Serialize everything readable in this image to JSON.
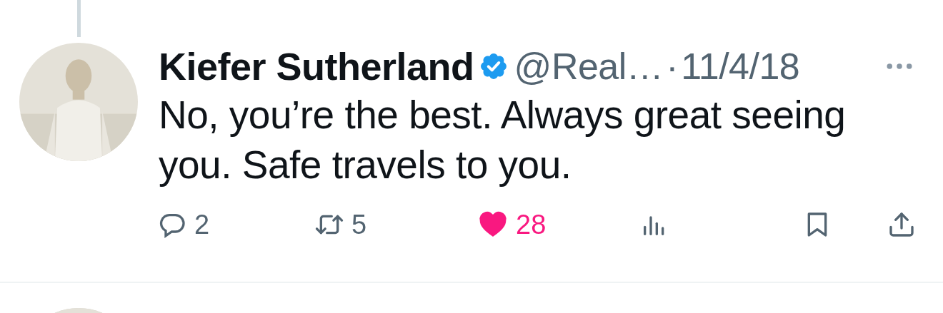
{
  "tweet": {
    "author": "Kiefer Sutherland",
    "verified": true,
    "handle": "@Real…",
    "separator": "·",
    "date": "11/4/18",
    "text": "No, you’re the best. Always great seeing you. Safe travels to you.",
    "actions": [
      {
        "kind": "reply",
        "count": "2",
        "active": false
      },
      {
        "kind": "retweet",
        "count": "5",
        "active": false
      },
      {
        "kind": "like",
        "count": "28",
        "active": true
      },
      {
        "kind": "views"
      },
      {
        "kind": "bookmark"
      },
      {
        "kind": "share"
      }
    ]
  }
}
